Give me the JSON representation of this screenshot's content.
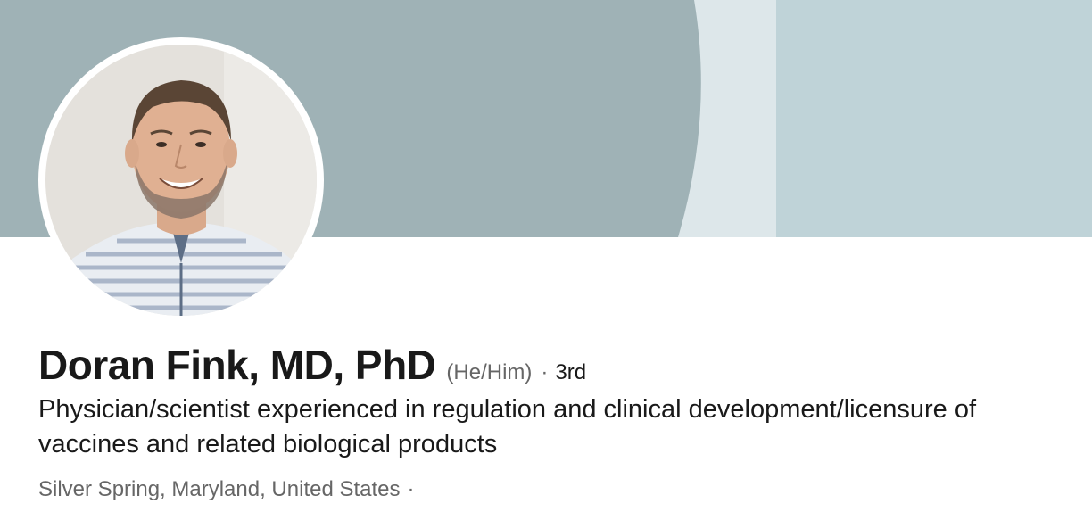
{
  "profile": {
    "name": "Doran Fink, MD, PhD",
    "pronouns": "(He/Him)",
    "separator": "·",
    "connection_degree": "3rd",
    "headline": "Physician/scientist experienced in regulation and clinical development/licensure of vaccines and related biological products",
    "location": "Silver Spring, Maryland, United States",
    "location_separator": "·"
  },
  "colors": {
    "banner_dark": "#9fb2b6",
    "banner_light": "#dde7ea",
    "banner_right": "#bfd3d8",
    "text_primary": "#191919",
    "text_secondary": "#666666"
  }
}
